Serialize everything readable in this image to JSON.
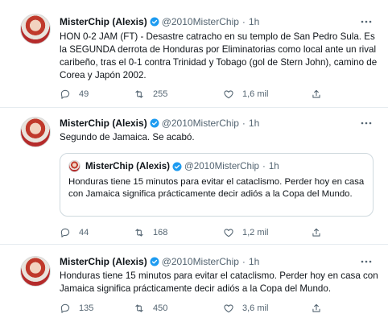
{
  "tweets": [
    {
      "author": "MisterChip (Alexis)",
      "handle": "@2010MisterChip",
      "dot": "·",
      "time": "1h",
      "text": "HON 0-2 JAM (FT) - Desastre catracho en su templo de San Pedro Sula. Es la SEGUNDA derrota de Honduras por Eliminatorias como local ante un rival caribeño, tras el 0-1 contra Trinidad y Tobago (gol de Stern John), camino de Corea y Japón 2002.",
      "replies": "49",
      "retweets": "255",
      "likes": "1,6 mil"
    },
    {
      "author": "MisterChip (Alexis)",
      "handle": "@2010MisterChip",
      "dot": "·",
      "time": "1h",
      "text": "Segundo de Jamaica. Se acabó.",
      "quote": {
        "author": "MisterChip (Alexis)",
        "handle": "@2010MisterChip",
        "dot": "·",
        "time": "1h",
        "text": "Honduras tiene 15 minutos para evitar el cataclismo. Perder hoy en casa con Jamaica significa prácticamente decir adiós a la Copa del Mundo."
      },
      "replies": "44",
      "retweets": "168",
      "likes": "1,2 mil"
    },
    {
      "author": "MisterChip (Alexis)",
      "handle": "@2010MisterChip",
      "dot": "·",
      "time": "1h",
      "text": "Honduras tiene 15 minutos para evitar el cataclismo. Perder hoy en casa con Jamaica significa prácticamente decir adiós a la Copa del Mundo.",
      "replies": "135",
      "retweets": "450",
      "likes": "3,6 mil"
    }
  ],
  "icons": {
    "verified": "verified-badge-icon",
    "more": "more-options-icon",
    "reply": "reply-icon",
    "retweet": "retweet-icon",
    "like": "like-icon",
    "share": "share-icon"
  },
  "colors": {
    "verified": "#1d9bf0",
    "secondary_text": "#536471",
    "divider": "#e6ecf0"
  }
}
